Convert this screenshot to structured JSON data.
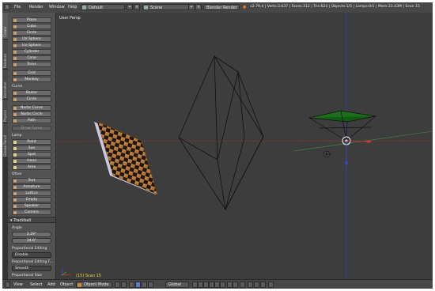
{
  "topbar": {
    "menu": [
      "File",
      "Render",
      "Window",
      "Help"
    ],
    "screen_layout": "Default",
    "scene": "Scene",
    "render_engine": "Blender Render",
    "stats": "v2.79.4 | Verts:3,637 | Faces:312 | Tris:624 | Objects:1/5 | Lamps:0/1 | Mem:23.43M | Scan 15"
  },
  "vtabs": [
    "Create",
    "Relations",
    "Animation",
    "Physics",
    "Grease Pencil"
  ],
  "toolshelf": {
    "mesh_items": [
      "Plane",
      "Cube",
      "Circle",
      "UV Sphere",
      "Ico Sphere",
      "Cylinder",
      "Cone",
      "Torus"
    ],
    "mesh_items2": [
      "Grid",
      "Monkey"
    ],
    "curve_heading": "Curve",
    "curve_items": [
      "Bezier",
      "Circle"
    ],
    "curve_items2": [
      "Nurbs Curve",
      "Nurbs Circle",
      "Path"
    ],
    "draw_curve": "Draw Curve",
    "lamp_heading": "Lamp",
    "lamp_items": [
      "Point",
      "Sun",
      "Spot",
      "Hemi",
      "Area"
    ],
    "other_heading": "Other",
    "other_items": [
      "Text",
      "Armature",
      "Lattice",
      "Empty",
      "Speaker",
      "Camera"
    ]
  },
  "trackball": {
    "title": "Trackball",
    "angle_label": "Angle",
    "angle_x": "2.29°",
    "angle_y": "34.6°",
    "prop_edit_label": "Proportional Editing",
    "prop_edit_value": "Disable",
    "prop_falloff_label": "Proportional Editing F...",
    "prop_falloff_value": "Smooth",
    "prop_size_label": "Proportional Size"
  },
  "viewport": {
    "title": "User Persp",
    "status": "(15) Scan 15"
  },
  "bottombar": {
    "view": "View",
    "select": "Select",
    "add": "Add",
    "object": "Object",
    "mode": "Object Mode",
    "orientation": "Global"
  },
  "colors": {
    "accent_orange": "#d08a3b",
    "status_yellow": "#e9d43e",
    "x_axis": "#b03030",
    "y_axis": "#3aa03a",
    "z_axis": "#3a48c8"
  }
}
